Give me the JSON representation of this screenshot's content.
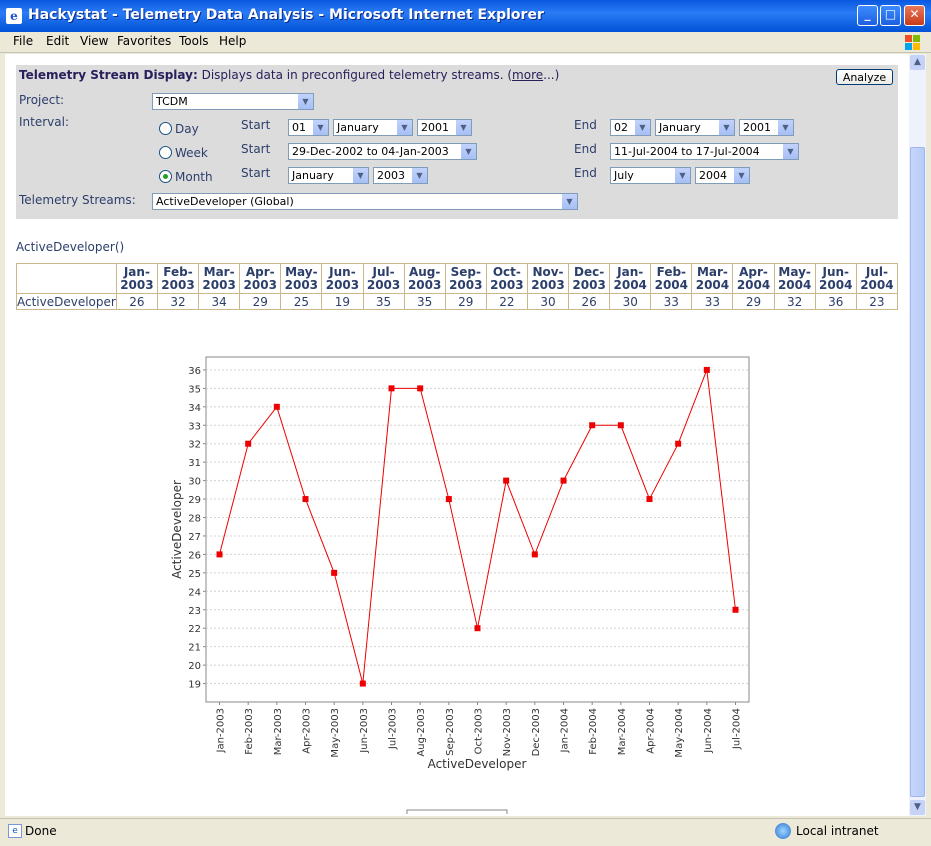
{
  "window": {
    "title": "Hackystat - Telemetry Data Analysis - Microsoft Internet Explorer"
  },
  "menu": [
    "File",
    "Edit",
    "View",
    "Favorites",
    "Tools",
    "Help"
  ],
  "panel": {
    "heading": "Telemetry Stream Display:",
    "description": "Displays data in preconfigured telemetry streams. (",
    "more_link": "more",
    "more_suffix": "...)",
    "analyze_button": "Analyze",
    "project_label": "Project:",
    "project_value": "TCDM",
    "interval_label": "Interval:",
    "day_label": "Day",
    "week_label": "Week",
    "month_label": "Month",
    "start_label": "Start",
    "end_label": "End",
    "day_start": {
      "day": "01",
      "month": "January",
      "year": "2001"
    },
    "day_end": {
      "day": "02",
      "month": "January",
      "year": "2001"
    },
    "week_start": "29-Dec-2002 to 04-Jan-2003",
    "week_end": "11-Jul-2004 to 17-Jul-2004",
    "month_start": {
      "month": "January",
      "year": "2003"
    },
    "month_end": {
      "month": "July",
      "year": "2004"
    },
    "selected_interval": "Month",
    "streams_label": "Telemetry Streams:",
    "streams_value": "ActiveDeveloper (Global)"
  },
  "result_title": "ActiveDeveloper()",
  "table": {
    "row_label": "ActiveDeveloper",
    "headers": [
      [
        "Jan-",
        "2003"
      ],
      [
        "Feb-",
        "2003"
      ],
      [
        "Mar-",
        "2003"
      ],
      [
        "Apr-",
        "2003"
      ],
      [
        "May-",
        "2003"
      ],
      [
        "Jun-",
        "2003"
      ],
      [
        "Jul-",
        "2003"
      ],
      [
        "Aug-",
        "2003"
      ],
      [
        "Sep-",
        "2003"
      ],
      [
        "Oct-",
        "2003"
      ],
      [
        "Nov-",
        "2003"
      ],
      [
        "Dec-",
        "2003"
      ],
      [
        "Jan-",
        "2004"
      ],
      [
        "Feb-",
        "2004"
      ],
      [
        "Mar-",
        "2004"
      ],
      [
        "Apr-",
        "2004"
      ],
      [
        "May-",
        "2004"
      ],
      [
        "Jun-",
        "2004"
      ],
      [
        "Jul-",
        "2004"
      ]
    ],
    "values": [
      26,
      32,
      34,
      29,
      25,
      19,
      35,
      35,
      29,
      22,
      30,
      26,
      30,
      33,
      33,
      29,
      32,
      36,
      23
    ]
  },
  "chart_data": {
    "type": "line",
    "categories": [
      "Jan-2003",
      "Feb-2003",
      "Mar-2003",
      "Apr-2003",
      "May-2003",
      "Jun-2003",
      "Jul-2003",
      "Aug-2003",
      "Sep-2003",
      "Oct-2003",
      "Nov-2003",
      "Dec-2003",
      "Jan-2004",
      "Feb-2004",
      "Mar-2004",
      "Apr-2004",
      "May-2004",
      "Jun-2004",
      "Jul-2004"
    ],
    "series": [
      {
        "name": "ActiveDeveloper",
        "values": [
          26,
          32,
          34,
          29,
          25,
          19,
          35,
          35,
          29,
          22,
          30,
          26,
          30,
          33,
          33,
          29,
          32,
          36,
          23
        ]
      }
    ],
    "xlabel": "ActiveDeveloper",
    "ylabel": "ActiveDeveloper",
    "ylim": [
      18,
      36.7
    ],
    "yticks": [
      19,
      20,
      21,
      22,
      23,
      24,
      25,
      26,
      27,
      28,
      29,
      30,
      31,
      32,
      33,
      34,
      35,
      36
    ],
    "grid": true,
    "legend": "bottom",
    "color": "#EE0000"
  },
  "status": {
    "text": "Done",
    "zone": "Local intranet"
  }
}
